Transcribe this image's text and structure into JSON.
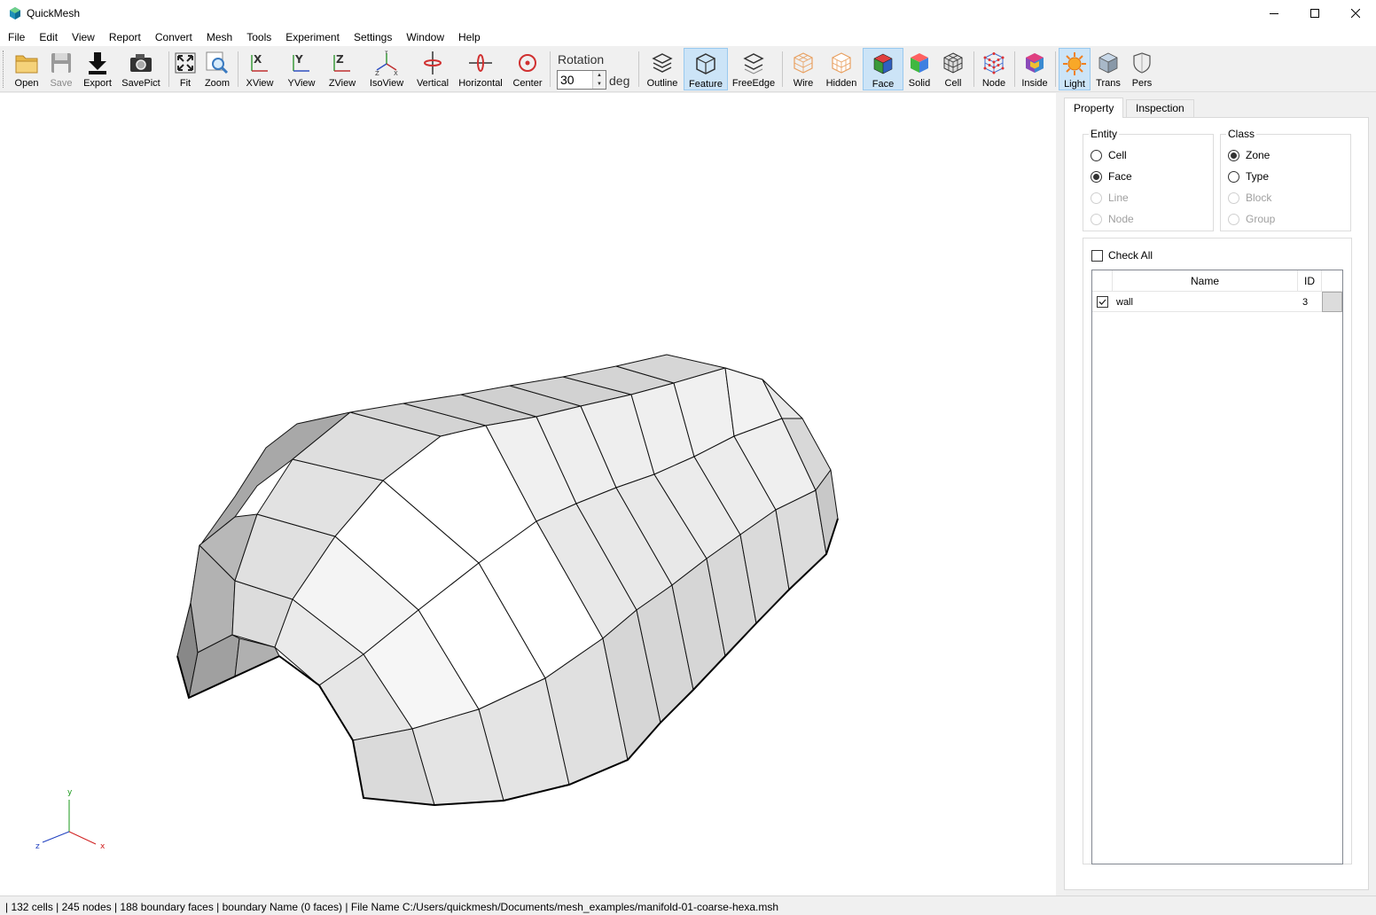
{
  "window": {
    "title": "QuickMesh",
    "icon": "quickmesh-logo-icon",
    "controls": [
      "minimize-icon",
      "maximize-icon",
      "close-icon"
    ]
  },
  "menu": [
    "File",
    "Edit",
    "View",
    "Report",
    "Convert",
    "Mesh",
    "Tools",
    "Experiment",
    "Settings",
    "Window",
    "Help"
  ],
  "toolbar": {
    "open": "Open",
    "save": "Save",
    "export": "Export",
    "savepict": "SavePict",
    "fit": "Fit",
    "zoom": "Zoom",
    "xview": "XView",
    "yview": "YView",
    "zview": "ZView",
    "isoview": "IsoView",
    "vertical": "Vertical",
    "horizontal": "Horizontal",
    "center": "Center",
    "rotation_label": "Rotation",
    "rotation_value": "30",
    "rotation_unit": "deg",
    "outline": "Outline",
    "feature": "Feature",
    "freeedge": "FreeEdge",
    "wire": "Wire",
    "hidden": "Hidden",
    "face": "Face",
    "solid": "Solid",
    "cell": "Cell",
    "node": "Node",
    "inside": "Inside",
    "light": "Light",
    "trans": "Trans",
    "pers": "Pers",
    "active": [
      "feature",
      "face",
      "light"
    ],
    "disabled": [
      "save"
    ]
  },
  "axes": {
    "x": "x",
    "y": "y",
    "z": "z"
  },
  "panel": {
    "tabs": [
      "Property",
      "Inspection"
    ],
    "active_tab": "Property",
    "entity": {
      "title": "Entity",
      "options": [
        "Cell",
        "Face",
        "Line",
        "Node"
      ],
      "selected": "Face",
      "disabled": [
        "Line",
        "Node"
      ]
    },
    "class": {
      "title": "Class",
      "options": [
        "Zone",
        "Type",
        "Block",
        "Group"
      ],
      "selected": "Zone",
      "disabled": [
        "Block",
        "Group"
      ]
    },
    "check_all": "Check All",
    "table": {
      "columns": [
        "Name",
        "ID"
      ],
      "rows": [
        {
          "checked": true,
          "name": "wall",
          "id": "3"
        }
      ]
    }
  },
  "status": "| 132 cells | 245 nodes | 188 boundary faces |  boundary Name  (0 faces) | File Name C:/Users/quickmesh/Documents/mesh_examples/manifold-01-coarse-hexa.msh"
}
